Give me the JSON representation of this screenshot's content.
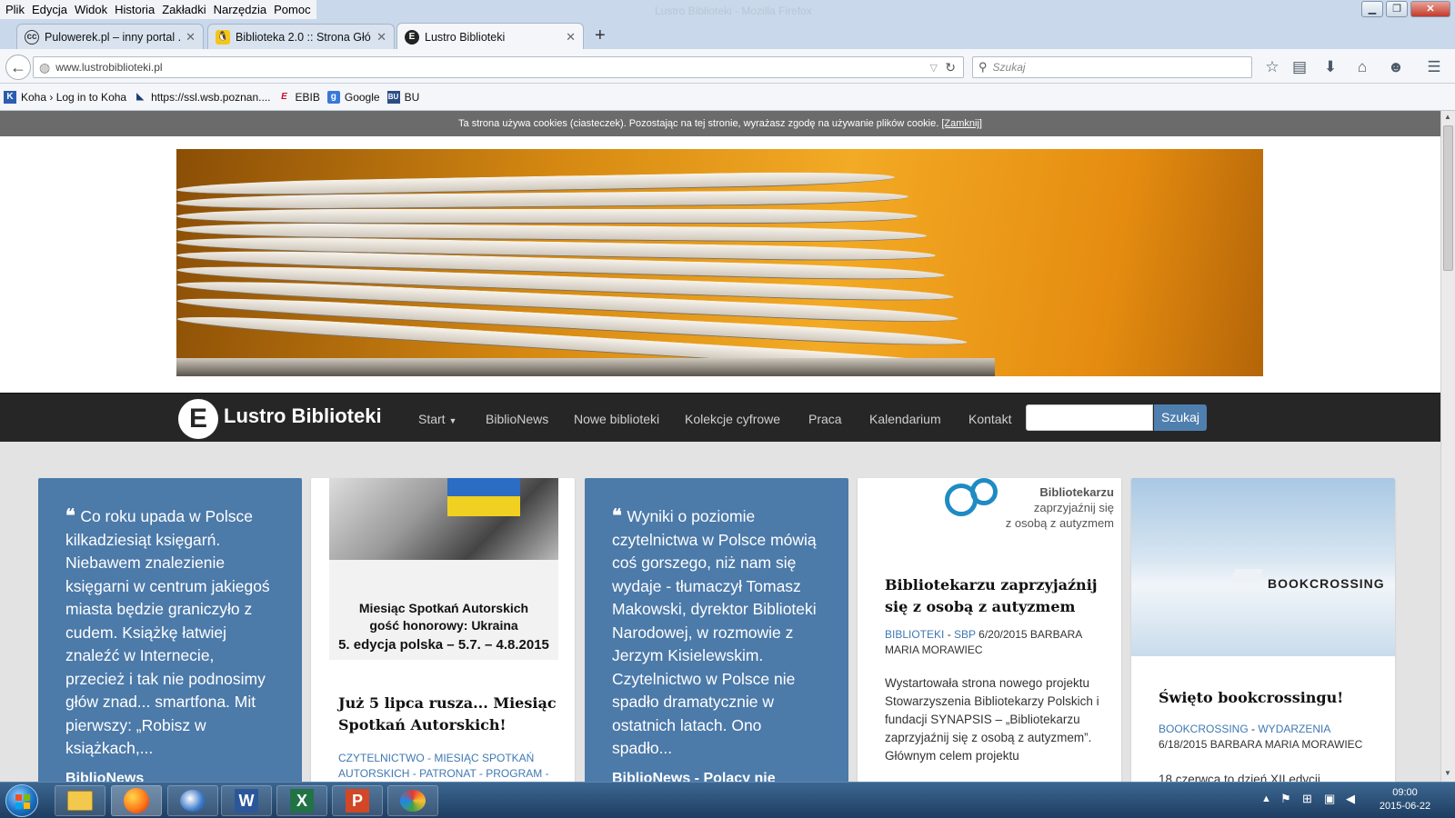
{
  "window": {
    "title": "Lustro Biblioteki - Mozilla Firefox",
    "menu": [
      "Plik",
      "Edycja",
      "Widok",
      "Historia",
      "Zakładki",
      "Narzędzia",
      "Pomoc"
    ]
  },
  "tabs": [
    {
      "label": "Pulowerek.pl – inny portal ...",
      "icon": "cc-icon"
    },
    {
      "label": "Biblioteka 2.0 :: Strona Głó...",
      "icon": "penguin-icon"
    },
    {
      "label": "Lustro Biblioteki",
      "icon": "lustro-icon"
    }
  ],
  "nav": {
    "url": "www.lustrobiblioteki.pl",
    "search_placeholder": "Szukaj"
  },
  "bookmarks": [
    {
      "label": "Koha › Log in to Koha",
      "icon": "koha-icon"
    },
    {
      "label": "https://ssl.wsb.poznan....",
      "icon": "wsb-icon"
    },
    {
      "label": "EBIB",
      "icon": "ebib-icon"
    },
    {
      "label": "Google",
      "icon": "google-icon"
    },
    {
      "label": "BU",
      "icon": "bu-icon"
    }
  ],
  "cookie": {
    "text": "Ta strona używa cookies (ciasteczek). Pozostając na tej stronie, wyrażasz zgodę na używanie plików cookie.",
    "close": "[Zamknij]"
  },
  "site": {
    "brand": "Lustro Biblioteki",
    "nav": [
      "Start",
      "BiblioNews",
      "Nowe biblioteki",
      "Kolekcje cyfrowe",
      "Praca",
      "Kalendarium",
      "Kontakt"
    ],
    "search_button": "Szukaj"
  },
  "cards": {
    "c1": {
      "quote": "Co roku upada w Polsce kilkadziesiąt księgarń. Niebawem znalezienie księgarni w centrum jakiegoś miasta będzie graniczyło z cudem. Książkę łatwiej znaleźć w Internecie, przecież i tak nie podnosimy głów znad... smartfona. Mit pierwszy: „Robisz w książkach,...",
      "footer": "BiblioNews"
    },
    "c2": {
      "poster_line1": "Miesiąc Spotkań Autorskich",
      "poster_line2": "gość honorowy: Ukraina",
      "poster_line3": "5. edycja polska – 5.7. – 4.8.2015",
      "title": "Już 5 lipca rusza... Miesiąc Spotkań Autorskich!",
      "cats": "CZYTELNICTWO - MIESIĄC SPOTKAŃ AUTORSKICH - PATRONAT - PROGRAM -"
    },
    "c3": {
      "quote": "Wyniki o poziomie czytelnictwa w Polsce mówią coś gorszego, niż nam się wydaje - tłumaczył Tomasz Makowski, dyrektor Biblioteki Narodowej, w rozmowie z Jerzym Kisielewskim. Czytelnictwo w Polsce nie spadło dramatycznie w ostatnich latach. Ono spadło...",
      "footer": "BiblioNews - Polacy nie"
    },
    "c4": {
      "logo_line1": "Bibliotekarzu",
      "logo_line2": "zaprzyjaźnij się",
      "logo_line3": "z osobą z autyzmem",
      "title": "Bibliotekarzu zaprzyjaźnij się z osobą z autyzmem",
      "cat1": "BIBLIOTEKI",
      "cat2": "SBP",
      "date": "6/20/2015",
      "author": "BARBARA MARIA MORAWIEC",
      "excerpt": "Wystartowała strona nowego projektu Stowarzyszenia Bibliotekarzy Polskich i fundacji SYNAPSIS – „Bibliotekarzu zaprzyjaźnij się z osobą z autyzmem”. Głównym celem projektu"
    },
    "c5": {
      "image_text": "BOOKCROSSING",
      "title": "Święto bookcrossingu!",
      "cat1": "BOOKCROSSING",
      "cat2": "WYDARZENIA",
      "date": "6/18/2015",
      "author": "BARBARA MARIA MORAWIEC",
      "excerpt": "18 czerwca to dzień XII edycji"
    }
  },
  "taskbar": {
    "time": "09:00",
    "date": "2015-06-22",
    "apps": [
      "explorer-icon",
      "firefox-icon",
      "thunderbird-icon",
      "word-icon",
      "excel-icon",
      "powerpoint-icon",
      "paint-icon"
    ]
  },
  "colors": {
    "nav_dark": "#262626",
    "card_blue": "#4c7aa9",
    "link_blue": "#3f78b3",
    "search_button": "#4f7fae"
  }
}
